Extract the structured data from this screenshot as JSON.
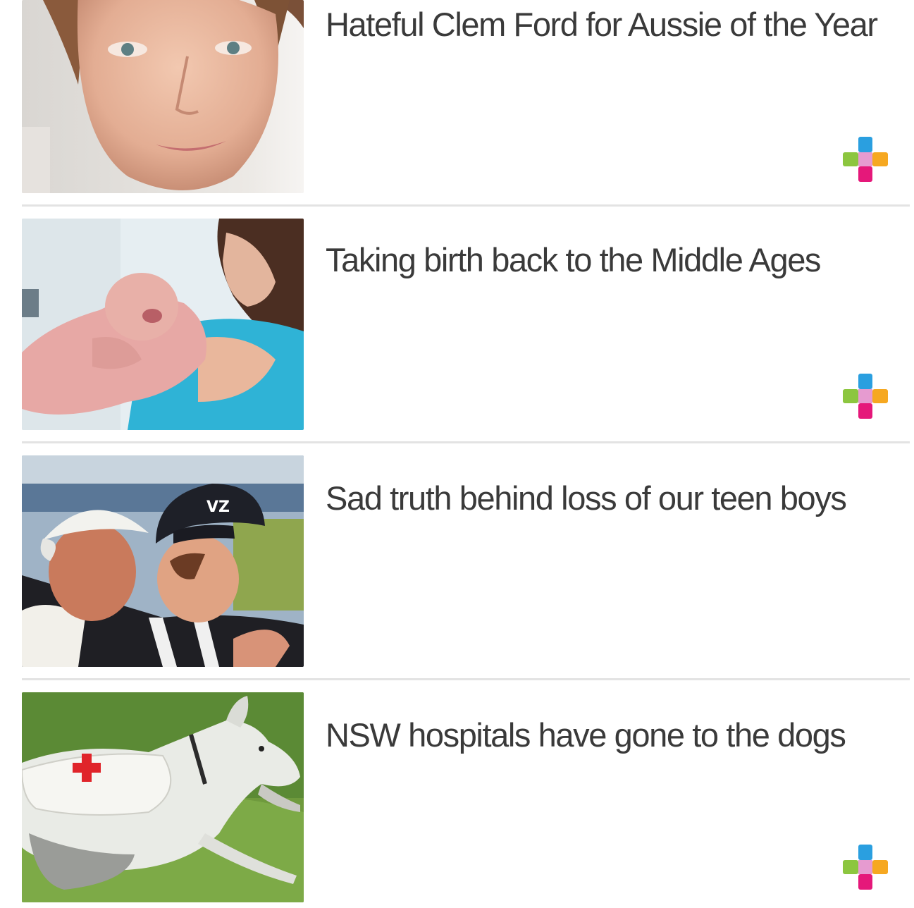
{
  "stories": [
    {
      "headline": "Hateful Clem Ford for Aussie of the Year",
      "image_subject": "woman-portrait",
      "has_plus_badge": true
    },
    {
      "headline": "Taking birth back to the Middle Ages",
      "image_subject": "mother-with-newborn",
      "has_plus_badge": true
    },
    {
      "headline": "Sad truth behind loss of our teen boys",
      "image_subject": "two-boys-in-caps",
      "has_plus_badge": false
    },
    {
      "headline": "NSW hospitals have gone to the dogs",
      "image_subject": "greyhound-with-red-cross",
      "has_plus_badge": true
    }
  ],
  "plus_badge": {
    "icon": "plus-icon",
    "colors": {
      "top": "#2a9fe0",
      "left": "#8cc63f",
      "center": "#e69bd0",
      "right": "#f6a821",
      "bottom": "#e5187a"
    }
  },
  "colors": {
    "headline_text": "#3a3a3a",
    "divider": "#e3e3e3",
    "background": "#ffffff"
  }
}
